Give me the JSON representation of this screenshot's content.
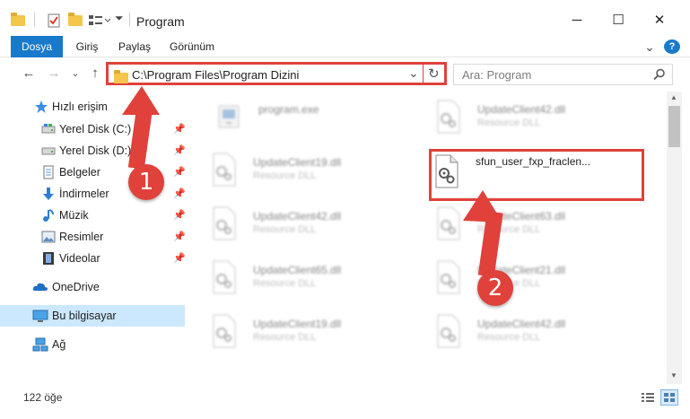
{
  "window": {
    "title": "Program",
    "minimize": "─",
    "maximize": "☐",
    "close": "✕"
  },
  "ribbon": {
    "tabs": [
      "Dosya",
      "Giriş",
      "Paylaş",
      "Görünüm"
    ],
    "collapse_glyph": "⌄",
    "help_glyph": "?"
  },
  "address_bar": {
    "path": "C:\\Program Files\\Program Dizini",
    "dropdown_glyph": "⌄",
    "refresh_glyph": "↻"
  },
  "search": {
    "placeholder": "Ara: Program",
    "icon": "search-icon"
  },
  "nav_pane": {
    "quick_access": "Hızlı erişim",
    "items": [
      {
        "label": "Yerel Disk (C:)",
        "icon": "drive-icon",
        "pinned": true
      },
      {
        "label": "Yerel Disk (D:)",
        "icon": "drive-icon",
        "pinned": true
      },
      {
        "label": "Belgeler",
        "icon": "documents-icon",
        "pinned": true
      },
      {
        "label": "İndirmeler",
        "icon": "download-icon",
        "pinned": true
      },
      {
        "label": "Müzik",
        "icon": "music-icon",
        "pinned": true
      },
      {
        "label": "Resimler",
        "icon": "pictures-icon",
        "pinned": true
      },
      {
        "label": "Videolar",
        "icon": "videos-icon",
        "pinned": true
      }
    ],
    "onedrive": "OneDrive",
    "this_pc": "Bu bilgisayar",
    "network": "Ağ"
  },
  "files": [
    {
      "name": "program.exe",
      "type": ""
    },
    {
      "name": "UpdateClient42.dll",
      "type": "Resource DLL"
    },
    {
      "name": "UpdateClient19.dll",
      "type": "Resource DLL"
    },
    {
      "name": "sfun_user_fxp_fraclen...",
      "type": ""
    },
    {
      "name": "UpdateClient42.dll",
      "type": "Resource DLL"
    },
    {
      "name": "UpdateClient63.dll",
      "type": "Resource DLL"
    },
    {
      "name": "UpdateClient65.dll",
      "type": "Resource DLL"
    },
    {
      "name": "UpdateClient21.dll",
      "type": "Resource DLL"
    },
    {
      "name": "UpdateClient19.dll",
      "type": "Resource DLL"
    },
    {
      "name": "UpdateClient42.dll",
      "type": "Resource DLL"
    }
  ],
  "status": {
    "count": "122 öğe"
  },
  "callouts": [
    "1",
    "2"
  ],
  "colors": {
    "accent": "#1979ca",
    "highlight": "#e0413b",
    "selected": "#cce8ff"
  }
}
